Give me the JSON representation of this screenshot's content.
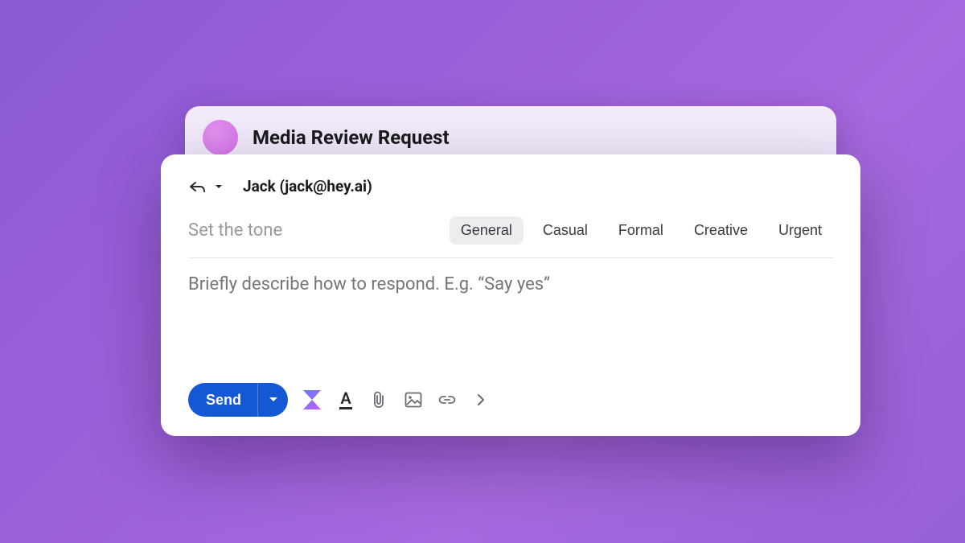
{
  "colors": {
    "accent_blue": "#1558d6",
    "bg_purple_start": "#8a5bd4",
    "bg_purple_end": "#9560d6"
  },
  "email": {
    "subject": "Media Review Request"
  },
  "compose": {
    "recipient": "Jack (jack@hey.ai)",
    "tone_label": "Set the tone",
    "body_placeholder": "Briefly describe how to respond. E.g. “Say yes”",
    "tones": [
      {
        "label": "General",
        "active": true
      },
      {
        "label": "Casual",
        "active": false
      },
      {
        "label": "Formal",
        "active": false
      },
      {
        "label": "Creative",
        "active": false
      },
      {
        "label": "Urgent",
        "active": false
      }
    ],
    "send_label": "Send"
  }
}
